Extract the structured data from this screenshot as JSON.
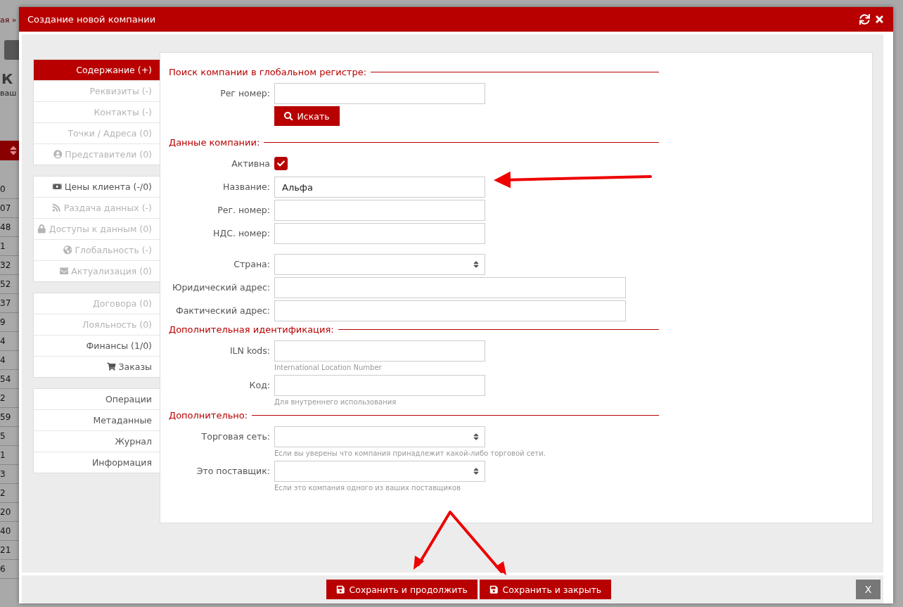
{
  "backdrop": {
    "breadcrumb": "ая »",
    "heading": "К",
    "subheading": "ваш",
    "row_numbers": [
      "0",
      "07",
      "48",
      "1",
      "32",
      "52",
      "37",
      "9",
      "4",
      "4",
      "54",
      "2",
      "59",
      "5",
      "1",
      "3",
      "2",
      "20",
      "40",
      "21",
      "6"
    ]
  },
  "window": {
    "title": "Создание новой компании"
  },
  "sidebar": {
    "groups": [
      {
        "items": [
          {
            "label": "Содержание (+)",
            "selected": true,
            "disabled": false
          },
          {
            "label": "Реквизиты (-)",
            "selected": false,
            "disabled": true
          },
          {
            "label": "Контакты (-)",
            "selected": false,
            "disabled": true
          },
          {
            "label": "Точки / Адреса (0)",
            "selected": false,
            "disabled": true
          },
          {
            "label": "Представители (0)",
            "selected": false,
            "disabled": true
          }
        ]
      },
      {
        "items": [
          {
            "label": "Цены клиента (-/0)",
            "selected": false,
            "disabled": false
          },
          {
            "label": "Раздача данных (-)",
            "selected": false,
            "disabled": true
          },
          {
            "label": "Доступы к данным (0)",
            "selected": false,
            "disabled": true
          },
          {
            "label": "Глобальность (-)",
            "selected": false,
            "disabled": true
          },
          {
            "label": "Актуализация (0)",
            "selected": false,
            "disabled": true
          }
        ]
      },
      {
        "items": [
          {
            "label": "Договора (0)",
            "selected": false,
            "disabled": true
          },
          {
            "label": "Лояльность (0)",
            "selected": false,
            "disabled": true
          },
          {
            "label": "Финансы (1/0)",
            "selected": false,
            "disabled": false
          },
          {
            "label": "Заказы",
            "selected": false,
            "disabled": false
          }
        ]
      },
      {
        "items": [
          {
            "label": "Операции",
            "selected": false,
            "disabled": false
          },
          {
            "label": "Метаданные",
            "selected": false,
            "disabled": false
          },
          {
            "label": "Журнал",
            "selected": false,
            "disabled": false
          },
          {
            "label": "Информация",
            "selected": false,
            "disabled": false
          }
        ]
      }
    ]
  },
  "sections": [
    {
      "title": "Поиск компании в глобальном регистре:",
      "fields": [
        {
          "kind": "text",
          "label": "Рег номер:"
        },
        {
          "kind": "button",
          "label": "Искать"
        }
      ]
    },
    {
      "title": "Данные компании:",
      "fields": [
        {
          "kind": "checkbox",
          "label": "Активна",
          "checked": true
        },
        {
          "kind": "text",
          "label": "Название:",
          "value": "Альфа"
        },
        {
          "kind": "text",
          "label": "Рег. номер:"
        },
        {
          "kind": "text",
          "label": "НДС. номер:"
        },
        {
          "kind": "select",
          "label": "Страна:"
        },
        {
          "kind": "wide",
          "label": "Юридический адрес:"
        },
        {
          "kind": "wide",
          "label": "Фактический адрес:"
        }
      ]
    },
    {
      "title": "Дополнительная идентификация:",
      "fields": [
        {
          "kind": "text",
          "label": "ILN kods:",
          "hint": "International Location Number"
        },
        {
          "kind": "text",
          "label": "Код:",
          "hint": "Для внутреннего использования"
        }
      ]
    },
    {
      "title": "Дополнительно:",
      "fields": [
        {
          "kind": "select",
          "label": "Торговая сеть:",
          "hint": "Если вы уверены что компания принадлежит какой-либо торговой сети."
        },
        {
          "kind": "select",
          "label": "Это поставщик:",
          "hint": "Если это компания одного из ваших поставщиков"
        }
      ]
    }
  ],
  "footer": {
    "buttons": [
      "Сохранить и продолжить",
      "Сохранить и закрыть"
    ],
    "close": "X"
  }
}
